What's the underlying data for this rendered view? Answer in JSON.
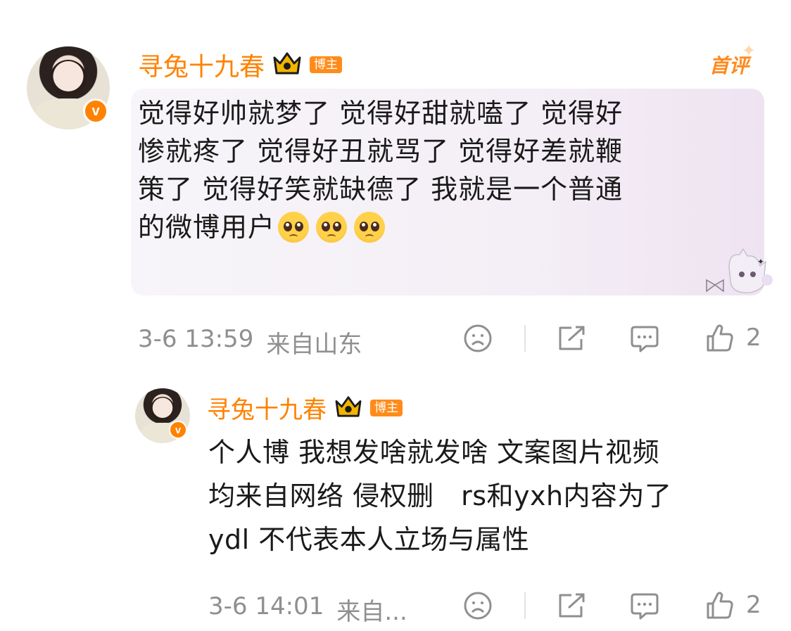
{
  "comment": {
    "username": "寻兔十九春",
    "badge_label": "博主",
    "first_comment_tag": "首评",
    "text": "觉得好帅就梦了 觉得好甜就嗑了 觉得好惨就疼了 觉得好丑就骂了 觉得好差就鞭策了 觉得好笑就缺德了 我就是一个普通的微博用户",
    "lines": [
      "觉得好帅就梦了 觉得好甜就嗑了 觉得好",
      "惨就疼了 觉得好丑就骂了 觉得好差就鞭",
      "策了 觉得好笑就缺德了 我就是一个普通",
      "的微博用户"
    ],
    "emojis": [
      "pleading-face",
      "pleading-face",
      "pleading-face"
    ],
    "time": "3-6 13:59",
    "location": "来自山东",
    "like_count": "2"
  },
  "reply": {
    "username": "寻兔十九春",
    "badge_label": "博主",
    "lines": [
      "个人博 我想发啥就发啥 文案图片视频",
      "均来自网络 侵权删　rs和yxh内容为了",
      "ydl 不代表本人立场与属性"
    ],
    "time": "3-6 14:01",
    "location": "来自...",
    "like_count": "2"
  },
  "icons": {
    "dislike": "sad-face-icon",
    "share": "share-icon",
    "comment": "comment-icon",
    "like": "thumbs-up-icon",
    "verified": "verified-v-icon",
    "crown": "crown-icon"
  },
  "colors": {
    "username": "#ff8200",
    "badge": "#ff8c1a",
    "meta": "#8f8f8f"
  }
}
